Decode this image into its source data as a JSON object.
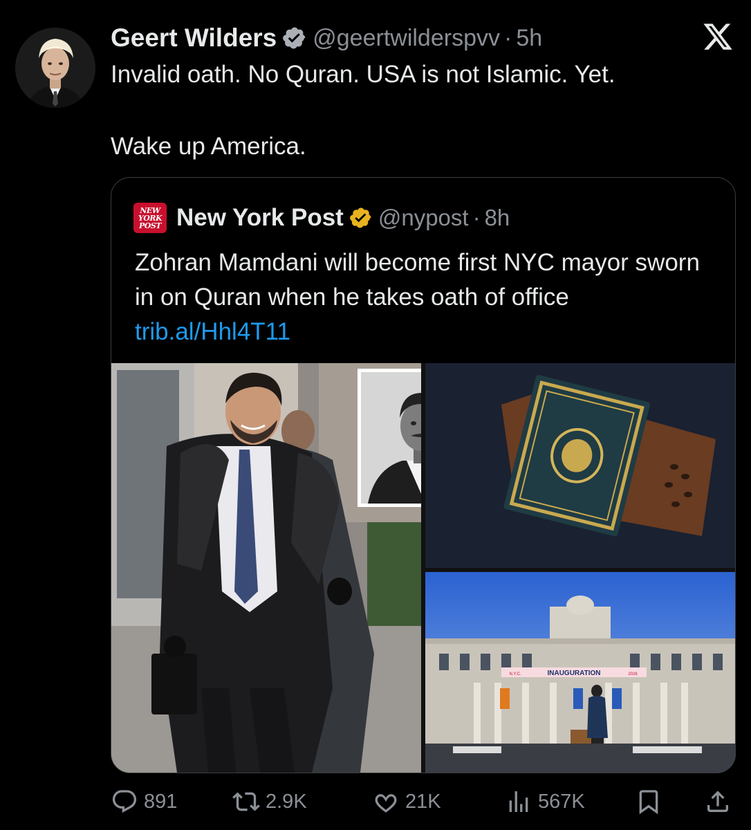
{
  "tweet": {
    "author_name": "Geert Wilders",
    "author_handle": "@geertwilderspvv",
    "separator": "·",
    "time": "5h",
    "text": "Invalid oath. No Quran. USA is not Islamic. Yet.\n\nWake up America."
  },
  "quoted_tweet": {
    "author_name": "New York Post",
    "author_handle": "@nypost",
    "separator": "·",
    "time": "8h",
    "logo_lines": [
      "NEW",
      "YORK",
      "POST"
    ],
    "text": "Zohran Mamdani will become first NYC mayor sworn in on Quran when he takes oath of office ",
    "link": "trib.al/Hhl4T11",
    "media": {
      "banner_text": "INAUGURATION",
      "banner_left": "N.Y.C.",
      "banner_right": "2026"
    }
  },
  "actions": {
    "replies": "891",
    "reposts": "2.9K",
    "likes": "21K",
    "views": "567K"
  },
  "colors": {
    "background": "#000000",
    "text": "#e7e9ea",
    "muted": "#8b9096",
    "link": "#1d9bf0",
    "verified_badge": "#e8b21f",
    "nypost_red": "#c8102e"
  },
  "icons": [
    "x-logo-icon",
    "verified-badge-icon",
    "reply-icon",
    "repost-icon",
    "like-icon",
    "views-icon",
    "bookmark-icon",
    "share-icon"
  ]
}
